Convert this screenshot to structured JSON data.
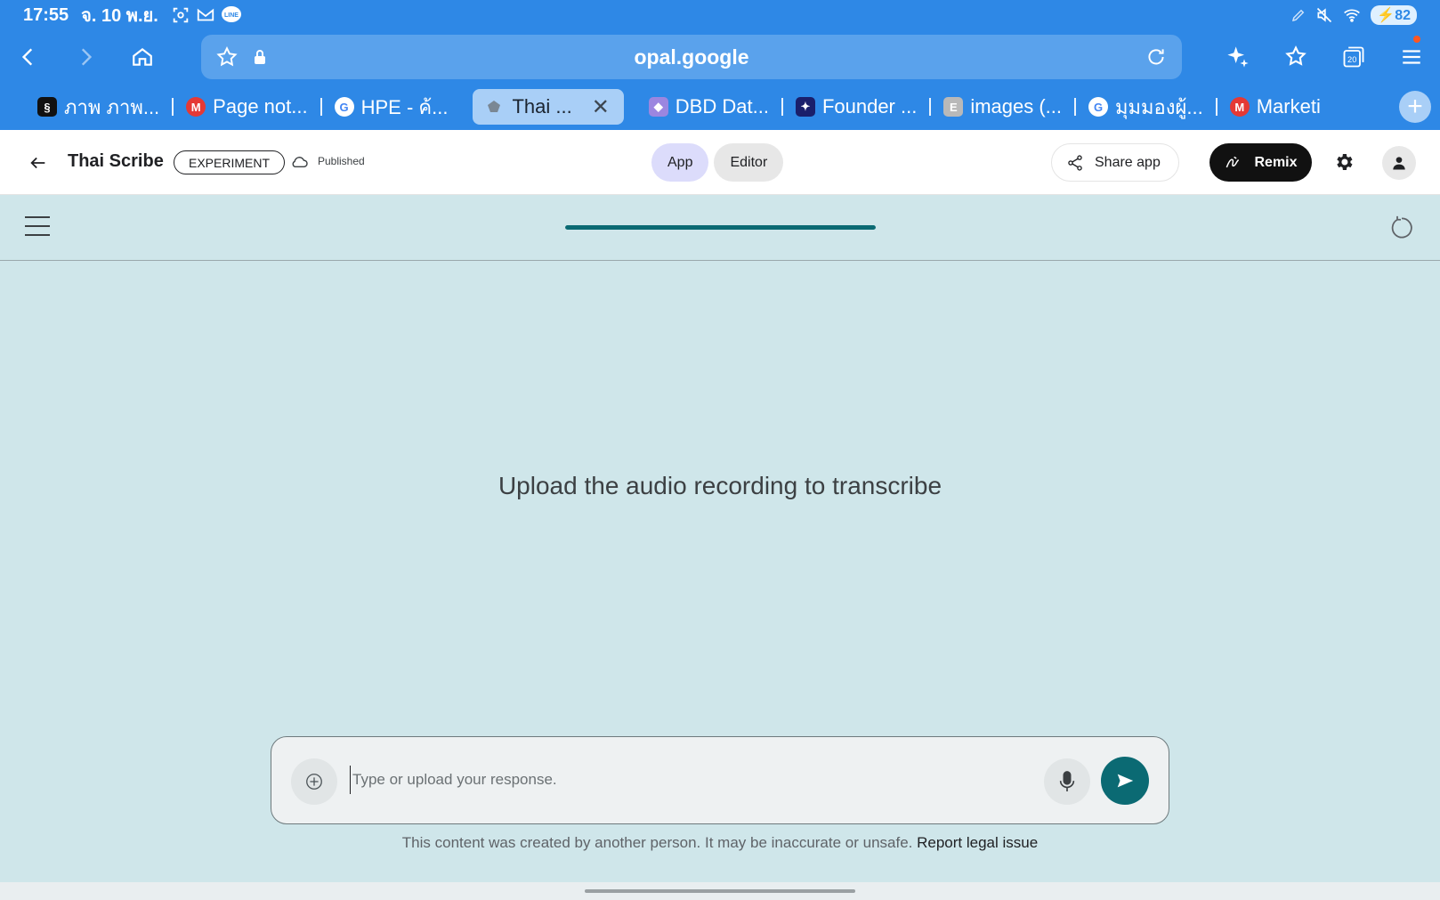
{
  "status_bar": {
    "time": "17:55",
    "date": "จ. 10 พ.ย.",
    "battery": "82"
  },
  "browser": {
    "url": "opal.google",
    "tabs": [
      {
        "label": "ภาพ ภาพ...",
        "favicon": "dark-s-favicon"
      },
      {
        "label": "Page not...",
        "favicon": "red-m-favicon"
      },
      {
        "label": "HPE - ค้...",
        "favicon": "google-favicon"
      },
      {
        "label": "Thai ...",
        "favicon": "opal-favicon",
        "active": true
      },
      {
        "label": "DBD Dat...",
        "favicon": "cube-favicon"
      },
      {
        "label": "Founder ...",
        "favicon": "navy-favicon"
      },
      {
        "label": "images (...",
        "favicon": "e-favicon"
      },
      {
        "label": "มุมมองผู้...",
        "favicon": "google-favicon"
      },
      {
        "label": "Marketi",
        "favicon": "red-m-favicon"
      }
    ]
  },
  "app_header": {
    "title": "Thai Scribe",
    "badge": "EXPERIMENT",
    "status": "Published",
    "segments": {
      "app": "App",
      "editor": "Editor"
    },
    "share_label": "Share app",
    "remix_label": "Remix"
  },
  "progress": {
    "value": 1.0
  },
  "main": {
    "prompt": "Upload the audio recording to transcribe"
  },
  "composer": {
    "placeholder": "Type or upload your response.",
    "value": ""
  },
  "footer": {
    "disclaimer": "This content was created by another person. It may be inaccurate or unsafe.",
    "report_link": "Report legal issue"
  },
  "colors": {
    "browser_chrome": "#2e88e6",
    "page_background": "#cfe6ea",
    "accent": "#0b6a73"
  }
}
